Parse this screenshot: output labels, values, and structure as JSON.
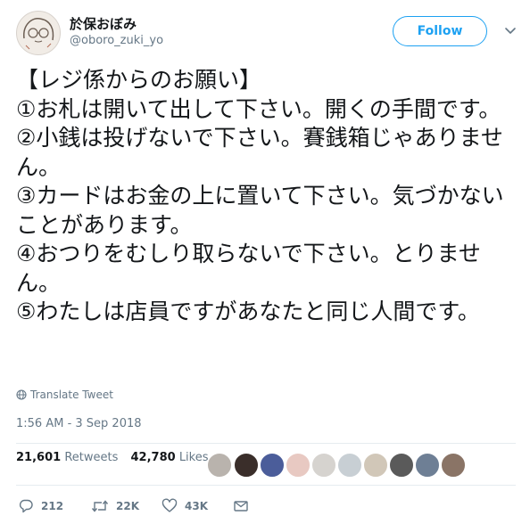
{
  "user": {
    "display_name": "於保おぼみ",
    "handle": "@oboro_zuki_yo",
    "follow_label": "Follow"
  },
  "tweet": {
    "text": "【レジ係からのお願い】\n①お札は開いて出して下さい。開くの手間です。\n②小銭は投げないで下さい。賽銭箱じゃありません。\n③カードはお金の上に置いて下さい。気づかないことがあります。\n④おつりをむしり取らないで下さい。とりません。\n⑤わたしは店員ですがあなたと同じ人間です。",
    "translate_label": "Translate Tweet",
    "timestamp": "1:56 AM - 3 Sep 2018"
  },
  "stats": {
    "retweets_count": "21,601",
    "retweets_label": "Retweets",
    "likes_count": "42,780",
    "likes_label": "Likes"
  },
  "actions": {
    "replies": "212",
    "retweets": "22K",
    "likes": "43K"
  },
  "colors": {
    "accent": "#1da1f2",
    "muted": "#657786",
    "text": "#14171a"
  }
}
